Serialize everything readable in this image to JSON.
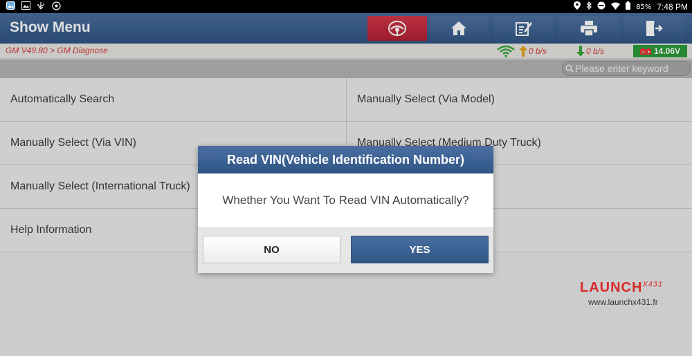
{
  "status_bar": {
    "battery": "85%",
    "time": "7:48 PM"
  },
  "app": {
    "title": "Show Menu",
    "toolbar": [
      "wheel-icon",
      "home-icon",
      "edit-icon",
      "print-icon",
      "exit-icon"
    ],
    "accent_color": "#2f5584",
    "active_color": "#c62a3b"
  },
  "breadcrumb": "GM V49.80 > GM Diagnose",
  "network": {
    "upload": "0 b/s",
    "download": "0 b/s"
  },
  "voltage": "14.06V",
  "search": {
    "placeholder": "Please enter keyword"
  },
  "menu": {
    "items": [
      "Automatically Search",
      "Manually Select (Via Model)",
      "Manually Select (Via VIN)",
      "Manually Select (Medium Duty Truck)",
      "Manually Select (International Truck)",
      "",
      "Help Information",
      ""
    ]
  },
  "dialog": {
    "title": "Read VIN(Vehicle Identification Number)",
    "message": "Whether You Want To Read VIN Automatically?",
    "no_label": "NO",
    "yes_label": "YES"
  },
  "watermark": {
    "logo": "LAUNCH",
    "logo_suffix": "X431",
    "url": "www.launchx431.fr"
  }
}
